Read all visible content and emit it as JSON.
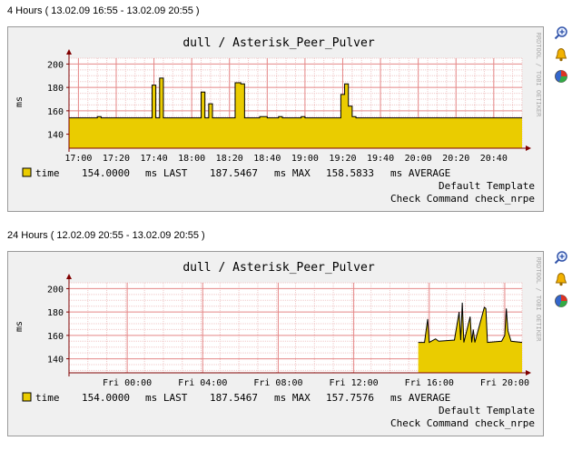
{
  "graphs": [
    {
      "period": "4 Hours ( 13.02.09 16:55 - 13.02.09 20:55 )",
      "title": "dull / Asterisk_Peer_Pulver",
      "ylabel": "ms",
      "watermark": "RRDTOOL / TOBI OETIKER",
      "legend": {
        "name": "time",
        "last": "154.0000",
        "last_label": "ms LAST",
        "max": "187.5467",
        "max_label": "ms MAX",
        "avg": "158.5833",
        "avg_label": "ms AVERAGE"
      },
      "template_line": "Default Template",
      "command_line": "Check Command check_nrpe"
    },
    {
      "period": "24 Hours ( 12.02.09 20:55 - 13.02.09 20:55 )",
      "title": "dull / Asterisk_Peer_Pulver",
      "ylabel": "ms",
      "watermark": "RRDTOOL / TOBI OETIKER",
      "legend": {
        "name": "time",
        "last": "154.0000",
        "last_label": "ms LAST",
        "max": "187.5467",
        "max_label": "ms MAX",
        "avg": "157.7576",
        "avg_label": "ms AVERAGE"
      },
      "template_line": "Default Template",
      "command_line": "Check Command check_nrpe"
    }
  ],
  "icons": [
    "zoom-icon",
    "bell-icon",
    "pie-chart-icon"
  ],
  "colors": {
    "area": "#EACC00",
    "line": "#000000",
    "grid_major": "#e58888",
    "grid_minor": "#f0c8c8",
    "axis": "#800000",
    "background": "#ffffff",
    "frame": "#f0f0f0"
  },
  "chart_data": [
    {
      "type": "area",
      "title": "dull / Asterisk_Peer_Pulver",
      "ylabel": "ms",
      "yticks": [
        140,
        160,
        180,
        200
      ],
      "ylim": [
        128,
        205
      ],
      "xlim": [
        "16:55",
        "20:55"
      ],
      "xticks": [
        "17:00",
        "17:20",
        "17:40",
        "18:00",
        "18:20",
        "18:40",
        "19:00",
        "19:20",
        "19:40",
        "20:00",
        "20:20",
        "20:40"
      ],
      "series": [
        {
          "name": "time",
          "steps": [
            [
              "16:55",
              154
            ],
            [
              "17:10",
              155
            ],
            [
              "17:12",
              154
            ],
            [
              "17:39",
              182
            ],
            [
              "17:41",
              154
            ],
            [
              "17:43",
              188
            ],
            [
              "17:45",
              154
            ],
            [
              "17:55",
              154
            ],
            [
              "17:59",
              154
            ],
            [
              "18:05",
              176
            ],
            [
              "18:07",
              154
            ],
            [
              "18:09",
              166
            ],
            [
              "18:11",
              154
            ],
            [
              "18:23",
              184
            ],
            [
              "18:26",
              183
            ],
            [
              "18:28",
              154
            ],
            [
              "18:36",
              155
            ],
            [
              "18:40",
              154
            ],
            [
              "18:46",
              155
            ],
            [
              "18:48",
              154
            ],
            [
              "18:58",
              155
            ],
            [
              "19:00",
              154
            ],
            [
              "19:19",
              174
            ],
            [
              "19:21",
              183
            ],
            [
              "19:23",
              164
            ],
            [
              "19:25",
              155
            ],
            [
              "19:27",
              154
            ],
            [
              "20:55",
              154
            ]
          ]
        }
      ]
    },
    {
      "type": "area",
      "title": "dull / Asterisk_Peer_Pulver",
      "ylabel": "ms",
      "yticks": [
        140,
        160,
        180,
        200
      ],
      "ylim": [
        128,
        205
      ],
      "xlim": [
        "Thu 20:55",
        "Fri 20:55"
      ],
      "xticks": [
        "Fri 00:00",
        "Fri 04:00",
        "Fri 08:00",
        "Fri 12:00",
        "Fri 16:00",
        "Fri 20:00"
      ],
      "series": [
        {
          "name": "time",
          "data_start": "Fri 15:25",
          "points": [
            [
              "Fri 15:25",
              154
            ],
            [
              "Fri 15:45",
              154
            ],
            [
              "Fri 15:55",
              174
            ],
            [
              "Fri 16:00",
              154
            ],
            [
              "Fri 16:20",
              157
            ],
            [
              "Fri 16:30",
              155
            ],
            [
              "Fri 17:20",
              156
            ],
            [
              "Fri 17:35",
              180
            ],
            [
              "Fri 17:40",
              156
            ],
            [
              "Fri 17:45",
              188
            ],
            [
              "Fri 17:50",
              154
            ],
            [
              "Fri 18:10",
              176
            ],
            [
              "Fri 18:15",
              154
            ],
            [
              "Fri 18:20",
              165
            ],
            [
              "Fri 18:25",
              154
            ],
            [
              "Fri 18:55",
              184
            ],
            [
              "Fri 19:00",
              183
            ],
            [
              "Fri 19:05",
              154
            ],
            [
              "Fri 19:50",
              155
            ],
            [
              "Fri 20:00",
              160
            ],
            [
              "Fri 20:05",
              183
            ],
            [
              "Fri 20:10",
              164
            ],
            [
              "Fri 20:20",
              155
            ],
            [
              "Fri 20:55",
              154
            ]
          ]
        }
      ]
    }
  ]
}
